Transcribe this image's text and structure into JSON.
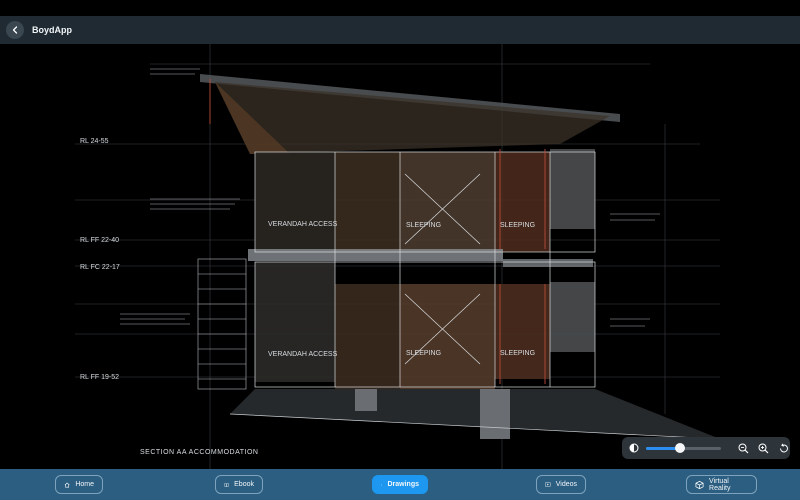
{
  "app": {
    "title": "BoydApp"
  },
  "drawing": {
    "title": "SECTION AA ACCOMMODATION",
    "levels": [
      "RL 24-55",
      "RL FF 22-40",
      "RL FC 22-17",
      "RL FF 19-52"
    ],
    "rooms": {
      "upper": [
        "VERANDAH ACCESS",
        "SLEEPING",
        "SLEEPING"
      ],
      "lower": [
        "VERANDAH ACCESS",
        "SLEEPING",
        "SLEEPING"
      ]
    }
  },
  "zoom": {
    "level_percent": 45
  },
  "tabs": [
    {
      "label": "Home",
      "icon": "home-icon",
      "active": false
    },
    {
      "label": "Ebook",
      "icon": "book-icon",
      "active": false
    },
    {
      "label": "Drawings",
      "icon": "layers-icon",
      "active": true
    },
    {
      "label": "Videos",
      "icon": "play-icon",
      "active": false
    },
    {
      "label": "Virtual Reality",
      "icon": "cube-icon",
      "active": false
    }
  ]
}
